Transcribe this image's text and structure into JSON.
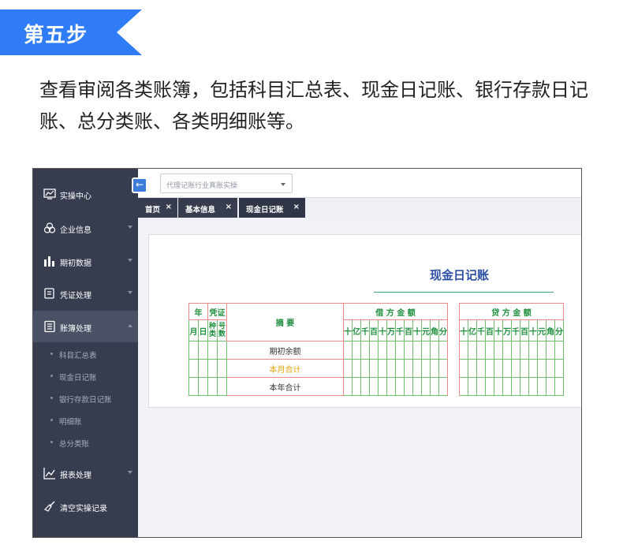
{
  "step": {
    "label": "第五步",
    "accent": "#2f7cf6"
  },
  "intro": "查看审阅各类账簿，包括科目汇总表、现金日记账、银行存款日记账、总分类账、各类明细账等。",
  "app": {
    "colors": {
      "sidebar": "#373d4f",
      "title": "#2c4fa3",
      "grid_red": "#f08a8a",
      "grid_green": "#6fbf6f",
      "header_text": "#1e8f3d",
      "highlight": "#e8a100"
    },
    "sidebar": {
      "items": [
        {
          "label": "实操中心",
          "icon": "monitor-chart-icon"
        },
        {
          "label": "企业信息",
          "icon": "circles-icon"
        },
        {
          "label": "期初数据",
          "icon": "bar-chart-icon"
        },
        {
          "label": "凭证处理",
          "icon": "document-edit-icon"
        },
        {
          "label": "账簿处理",
          "icon": "ledger-icon"
        },
        {
          "label": "报表处理",
          "icon": "line-chart-icon"
        },
        {
          "label": "清空实操记录",
          "icon": "broom-icon"
        }
      ],
      "subitems": [
        "科目汇总表",
        "现金日记账",
        "银行存款日记账",
        "明细账",
        "总分类账"
      ]
    },
    "collapse_icon": "arrow-left-icon",
    "select": {
      "value": "代理记账行业真账实操"
    },
    "tabs": [
      {
        "label": "首页",
        "close": "×"
      },
      {
        "label": "基本信息",
        "close": "×"
      },
      {
        "label": "现金日记账",
        "close": "×"
      }
    ],
    "ledger": {
      "title": "现金日记账",
      "year": "年",
      "voucher": "凭证",
      "month": "月",
      "day": "日",
      "kind": "种类",
      "number": "号数",
      "summary": "摘 要",
      "debit": "借 方 金 额",
      "credit": "贷 方 金 额",
      "digits": [
        "十",
        "亿",
        "千",
        "百",
        "十",
        "万",
        "千",
        "百",
        "十",
        "元",
        "角",
        "分"
      ],
      "rows": [
        "期初余额",
        "本月合计",
        "本年合计"
      ]
    }
  }
}
